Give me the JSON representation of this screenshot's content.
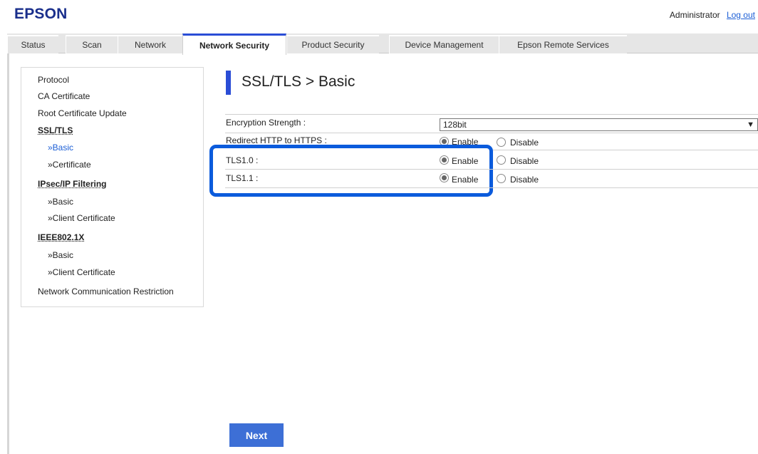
{
  "header": {
    "brand": "EPSON",
    "user": "Administrator",
    "logout_label": "Log out"
  },
  "tabs": [
    {
      "label": "Status"
    },
    {
      "label": "Scan"
    },
    {
      "label": "Network"
    },
    {
      "label": "Network Security"
    },
    {
      "label": "Product Security"
    },
    {
      "label": "Device Management"
    },
    {
      "label": "Epson Remote Services"
    }
  ],
  "sidebar": {
    "protocol": "Protocol",
    "ca_certificate": "CA Certificate",
    "root_certificate_update": "Root Certificate Update",
    "ssl_tls": "SSL/TLS",
    "ssl_basic": "»Basic",
    "ssl_certificate": "»Certificate",
    "ipsec": "IPsec/IP Filtering",
    "ipsec_basic": "»Basic",
    "ipsec_client_cert": "»Client Certificate",
    "ieee": "IEEE802.1X",
    "ieee_basic": "»Basic",
    "ieee_client_cert": "»Client Certificate",
    "ncr": "Network Communication Restriction"
  },
  "page": {
    "title": "SSL/TLS > Basic"
  },
  "form": {
    "encryption_label": "Encryption Strength :",
    "encryption_value": "128bit",
    "redirect_label": "Redirect HTTP to HTTPS :",
    "tls10_label": "TLS1.0 :",
    "tls11_label": "TLS1.1 :",
    "enable_label": "Enable",
    "disable_label": "Disable",
    "selected": {
      "redirect": "Enable",
      "tls10": "Enable",
      "tls11": "Enable"
    }
  },
  "buttons": {
    "next_label": "Next"
  },
  "colors": {
    "accent": "#2a4dd6",
    "highlight": "#0b5bdc",
    "brand": "#1a2f8c",
    "button": "#3d6fd6"
  }
}
